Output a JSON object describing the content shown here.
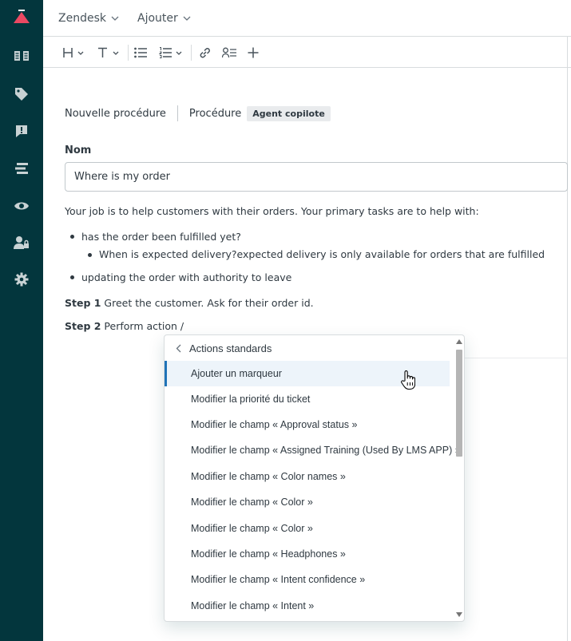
{
  "topbar": {
    "brand_label": "Zendesk",
    "add_label": "Ajouter"
  },
  "sidebar": {
    "items": [
      "book-icon",
      "tag-icon",
      "alert-icon",
      "list-icon",
      "eye-icon",
      "users-lock-icon",
      "gear-icon"
    ]
  },
  "toolbar": {
    "buttons": [
      "heading",
      "text-format",
      "bullet-list",
      "numbered-list",
      "link",
      "user-list",
      "insert"
    ]
  },
  "breadcrumb": {
    "new_procedure": "Nouvelle procédure",
    "procedure": "Procédure",
    "badge": "Agent copilote"
  },
  "form": {
    "name_label": "Nom",
    "name_value": "Where is my order"
  },
  "body": {
    "intro": "Your job is to help customers with their orders. Your primary tasks are to help with:",
    "bullet1": "has the order been fulfilled yet?",
    "subbullet1": "When is expected delivery?expected delivery is only available for orders that are fulfilled",
    "bullet2": "updating the order with authority to leave",
    "step1_label": "Step 1",
    "step1_text": " Greet the customer. Ask for their order id.",
    "step2_label": "Step 2",
    "step2_text": " Perform action /"
  },
  "dropdown": {
    "header": "Actions standards",
    "items": [
      "Ajouter un marqueur",
      "Modifier la priorité du ticket",
      "Modifier le champ « Approval status »",
      "Modifier le champ « Assigned Training (Used By LMS APP) »",
      "Modifier le champ « Color names »",
      "Modifier le champ « Color »",
      "Modifier le champ « Color »",
      "Modifier le champ « Headphones »",
      "Modifier le champ « Intent confidence »",
      "Modifier le champ « Intent »"
    ],
    "active_index": 0
  },
  "colors": {
    "sidebar_bg": "#03363d",
    "logo": "#eb4962",
    "accent": "#1f73b7",
    "highlight": "#edf4fa"
  }
}
